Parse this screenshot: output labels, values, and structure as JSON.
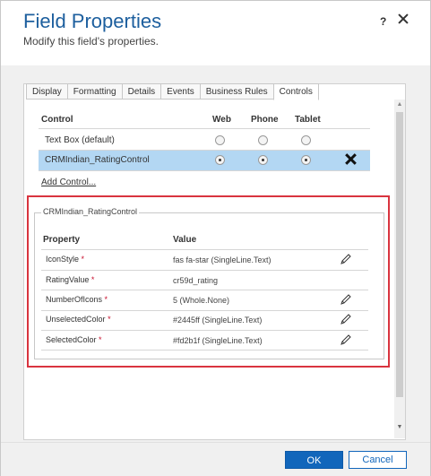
{
  "dialog": {
    "title": "Field Properties",
    "subtitle": "Modify this field's properties.",
    "help_label": "?"
  },
  "tabs": [
    {
      "label": "Display"
    },
    {
      "label": "Formatting"
    },
    {
      "label": "Details"
    },
    {
      "label": "Events"
    },
    {
      "label": "Business Rules"
    },
    {
      "label": "Controls"
    }
  ],
  "active_tab": "Controls",
  "controls_table": {
    "headers": {
      "control": "Control",
      "web": "Web",
      "phone": "Phone",
      "tablet": "Tablet"
    },
    "rows": [
      {
        "name": "Text Box (default)",
        "web": false,
        "phone": false,
        "tablet": false,
        "selected": false
      },
      {
        "name": "CRMIndian_RatingControl",
        "web": true,
        "phone": true,
        "tablet": true,
        "selected": true
      }
    ],
    "add_control_label": "Add Control..."
  },
  "properties_section": {
    "legend": "CRMIndian_RatingControl",
    "headers": {
      "property": "Property",
      "value": "Value"
    },
    "rows": [
      {
        "property": "IconStyle",
        "required": "*",
        "value": "fas fa-star (SingleLine.Text)",
        "editable": true
      },
      {
        "property": "RatingValue",
        "required": "*",
        "value": "cr59d_rating",
        "editable": false
      },
      {
        "property": "NumberOfIcons",
        "required": "*",
        "value": "5 (Whole.None)",
        "editable": true
      },
      {
        "property": "UnselectedColor",
        "required": "*",
        "value": "#2445ff (SingleLine.Text)",
        "editable": true
      },
      {
        "property": "SelectedColor",
        "required": "*",
        "value": "#fd2b1f (SingleLine.Text)",
        "editable": true
      }
    ]
  },
  "footer": {
    "ok_label": "OK",
    "cancel_label": "Cancel"
  },
  "colors": {
    "title": "#1d5f9e",
    "selected_row": "#b3d7f3",
    "highlight_border": "#d9343f",
    "primary_button": "#1166bb"
  }
}
